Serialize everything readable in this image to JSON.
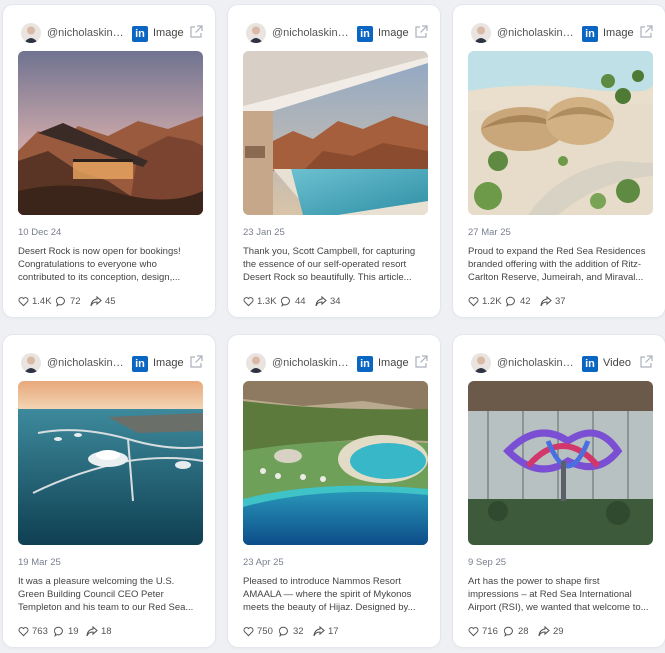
{
  "posts": [
    {
      "handle": "@nicholaskingi...",
      "media_type": "Image",
      "date": "10 Dec 24",
      "caption": "Desert Rock is now open for bookings! Congratulations to everyone who contributed to its conception, design,...",
      "likes": "1.4K",
      "comments": "72",
      "shares": "45"
    },
    {
      "handle": "@nicholaskingi...",
      "media_type": "Image",
      "date": "23 Jan 25",
      "caption": "Thank you, Scott Campbell, for capturing the essence of our self-operated resort Desert Rock so beautifully. This article...",
      "likes": "1.3K",
      "comments": "44",
      "shares": "34"
    },
    {
      "handle": "@nicholaskingi...",
      "media_type": "Image",
      "date": "27 Mar 25",
      "caption": "Proud to expand the Red Sea Residences branded offering with the addition of Ritz-Carlton Reserve, Jumeirah, and Miraval...",
      "likes": "1.2K",
      "comments": "42",
      "shares": "37"
    },
    {
      "handle": "@nicholaskingi...",
      "media_type": "Image",
      "date": "19 Mar 25",
      "caption": "It was a pleasure welcoming the U.S. Green Building Council CEO Peter Templeton and his team to our Red Sea...",
      "likes": "763",
      "comments": "19",
      "shares": "18"
    },
    {
      "handle": "@nicholaskingi...",
      "media_type": "Image",
      "date": "23 Apr 25",
      "caption": "Pleased to introduce Nammos Resort AMAALA — where the spirit of Mykonos meets the beauty of Hijaz. Designed by...",
      "likes": "750",
      "comments": "32",
      "shares": "17"
    },
    {
      "handle": "@nicholaskingi...",
      "media_type": "Video",
      "date": "9 Sep 25",
      "caption": "Art has the power to shape first impressions – at Red Sea International Airport (RSI), we wanted that welcome to...",
      "likes": "716",
      "comments": "28",
      "shares": "29"
    }
  ],
  "icons": {
    "platform": "linkedin-icon",
    "external": "external-link-icon",
    "like": "heart-icon",
    "comment": "comment-icon",
    "share": "share-icon"
  },
  "colors": {
    "linkedin": "#0a66c2",
    "background": "#eef0f4",
    "card": "#ffffff"
  }
}
